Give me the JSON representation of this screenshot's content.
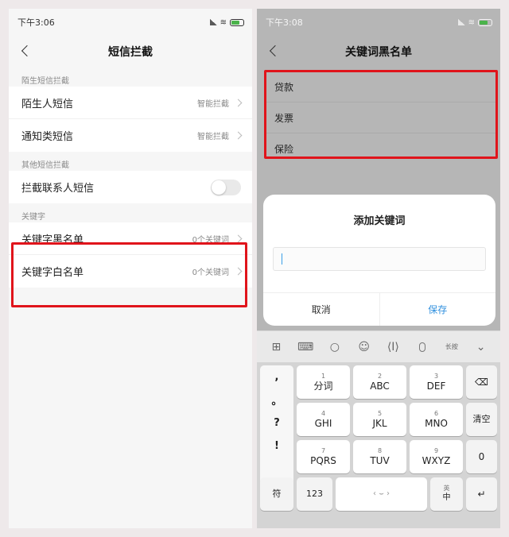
{
  "left": {
    "status_time": "下午3:06",
    "title": "短信拦截",
    "sections": [
      {
        "header": "陌生短信拦截",
        "rows": [
          {
            "label": "陌生人短信",
            "value": "智能拦截"
          },
          {
            "label": "通知类短信",
            "value": "智能拦截"
          }
        ]
      },
      {
        "header": "其他短信拦截",
        "rows": [
          {
            "label": "拦截联系人短信",
            "toggle": false
          }
        ]
      },
      {
        "header": "关键字",
        "rows": [
          {
            "label": "关键字黑名单",
            "value": "0个关键词"
          },
          {
            "label": "关键字白名单",
            "value": "0个关键词"
          }
        ]
      }
    ]
  },
  "right": {
    "status_time": "下午3:08",
    "title": "关键词黑名单",
    "keywords": [
      "贷款",
      "发票",
      "保险"
    ],
    "dialog": {
      "title": "添加关键词",
      "input_value": "",
      "cancel": "取消",
      "save": "保存"
    },
    "keyboard": {
      "toolbar_icons": [
        "grid-icon",
        "keyboard-icon",
        "search-icon",
        "emoji-icon",
        "cursor-icon",
        "mic-icon",
        "long-press-icon",
        "collapse-icon"
      ],
      "toolbar_small_label": "长按",
      "punct_keys": [
        ",",
        "。",
        "?",
        "!"
      ],
      "keys": [
        {
          "num": "1",
          "label": "分词"
        },
        {
          "num": "2",
          "label": "ABC"
        },
        {
          "num": "3",
          "label": "DEF"
        },
        {
          "num": "4",
          "label": "GHI"
        },
        {
          "num": "5",
          "label": "JKL"
        },
        {
          "num": "6",
          "label": "MNO"
        },
        {
          "num": "7",
          "label": "PQRS"
        },
        {
          "num": "8",
          "label": "TUV"
        },
        {
          "num": "9",
          "label": "WXYZ"
        }
      ],
      "clear": "清空",
      "zero": "0",
      "fu": "符",
      "num123": "123",
      "lang_top": "英",
      "lang_bottom": "中"
    }
  },
  "colors": {
    "highlight": "#e0141b",
    "accent": "#2f8fde"
  }
}
